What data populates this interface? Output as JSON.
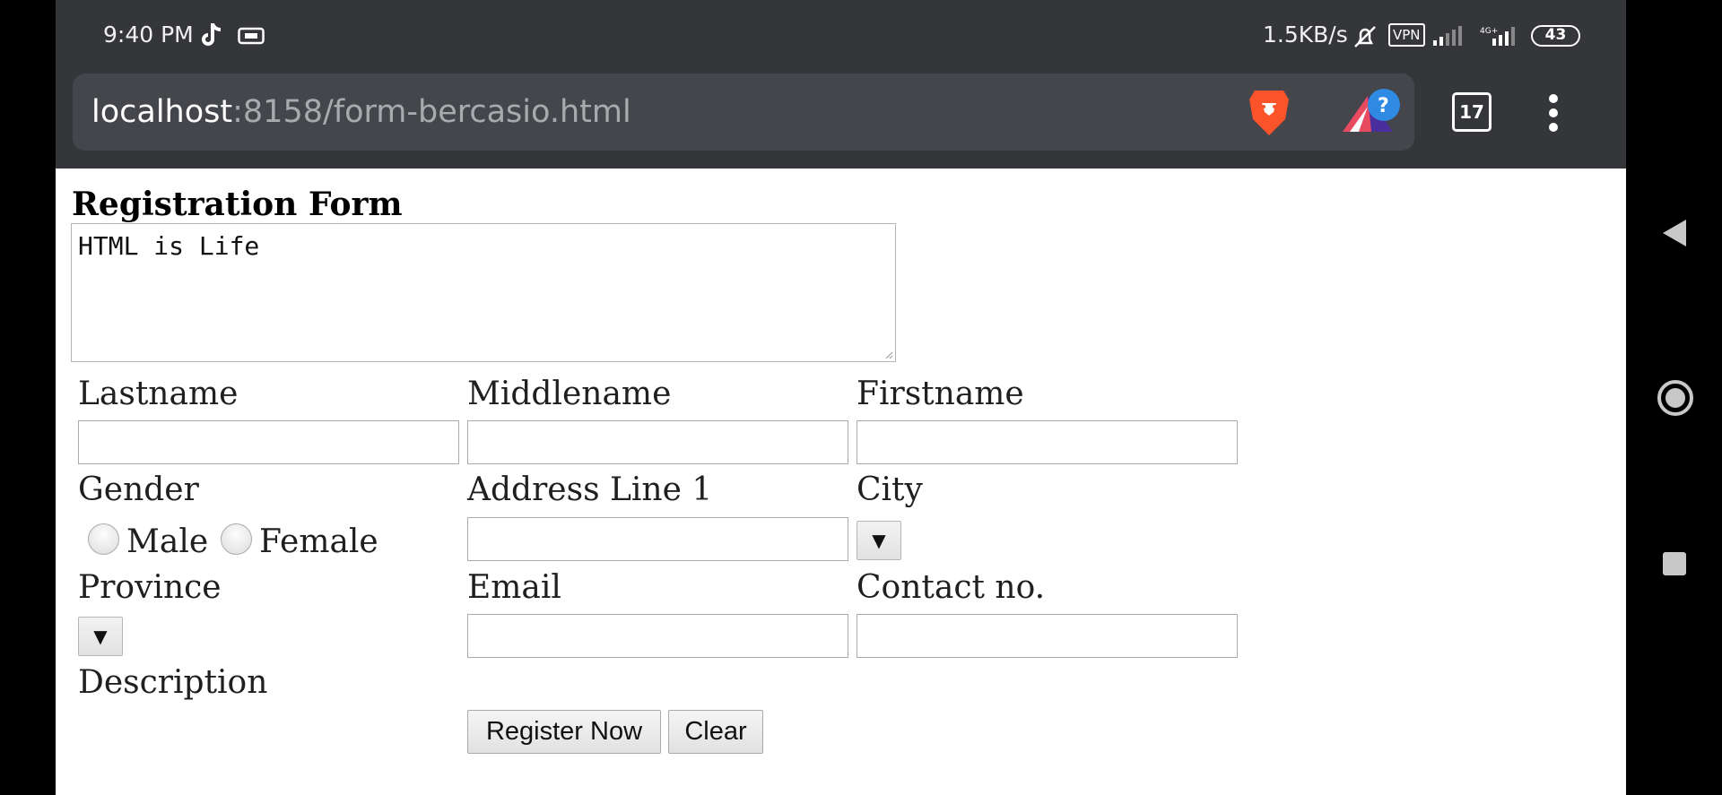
{
  "status_bar": {
    "time": "9:40 PM",
    "speed": "1.5KB/s",
    "vpn": "VPN",
    "battery": "43"
  },
  "browser": {
    "url_host": "localhost",
    "url_rest": ":8158/form-bercasio.html",
    "tab_count": "17"
  },
  "form": {
    "heading": "Registration Form",
    "textarea_value": "HTML is Life",
    "labels": {
      "lastname": "Lastname",
      "middlename": "Middlename",
      "firstname": "Firstname",
      "gender": "Gender",
      "address1": "Address Line 1",
      "city": "City",
      "province": "Province",
      "email": "Email",
      "contact": "Contact no.",
      "description": "Description"
    },
    "gender_options": [
      "Male",
      "Female"
    ],
    "select_arrow": "▼",
    "buttons": {
      "register": "Register Now",
      "clear": "Clear"
    }
  },
  "colors": {
    "chrome_bg": "#35363a",
    "urlbar_bg": "#44464b",
    "brave_orange": "#fb542b"
  },
  "icons": [
    "tiktok-icon",
    "cast-icon",
    "mute-icon",
    "signal-icon",
    "brave-lion-icon",
    "brave-rewards-icon",
    "tabs-icon",
    "more-icon",
    "back-icon",
    "home-icon",
    "recents-icon"
  ]
}
